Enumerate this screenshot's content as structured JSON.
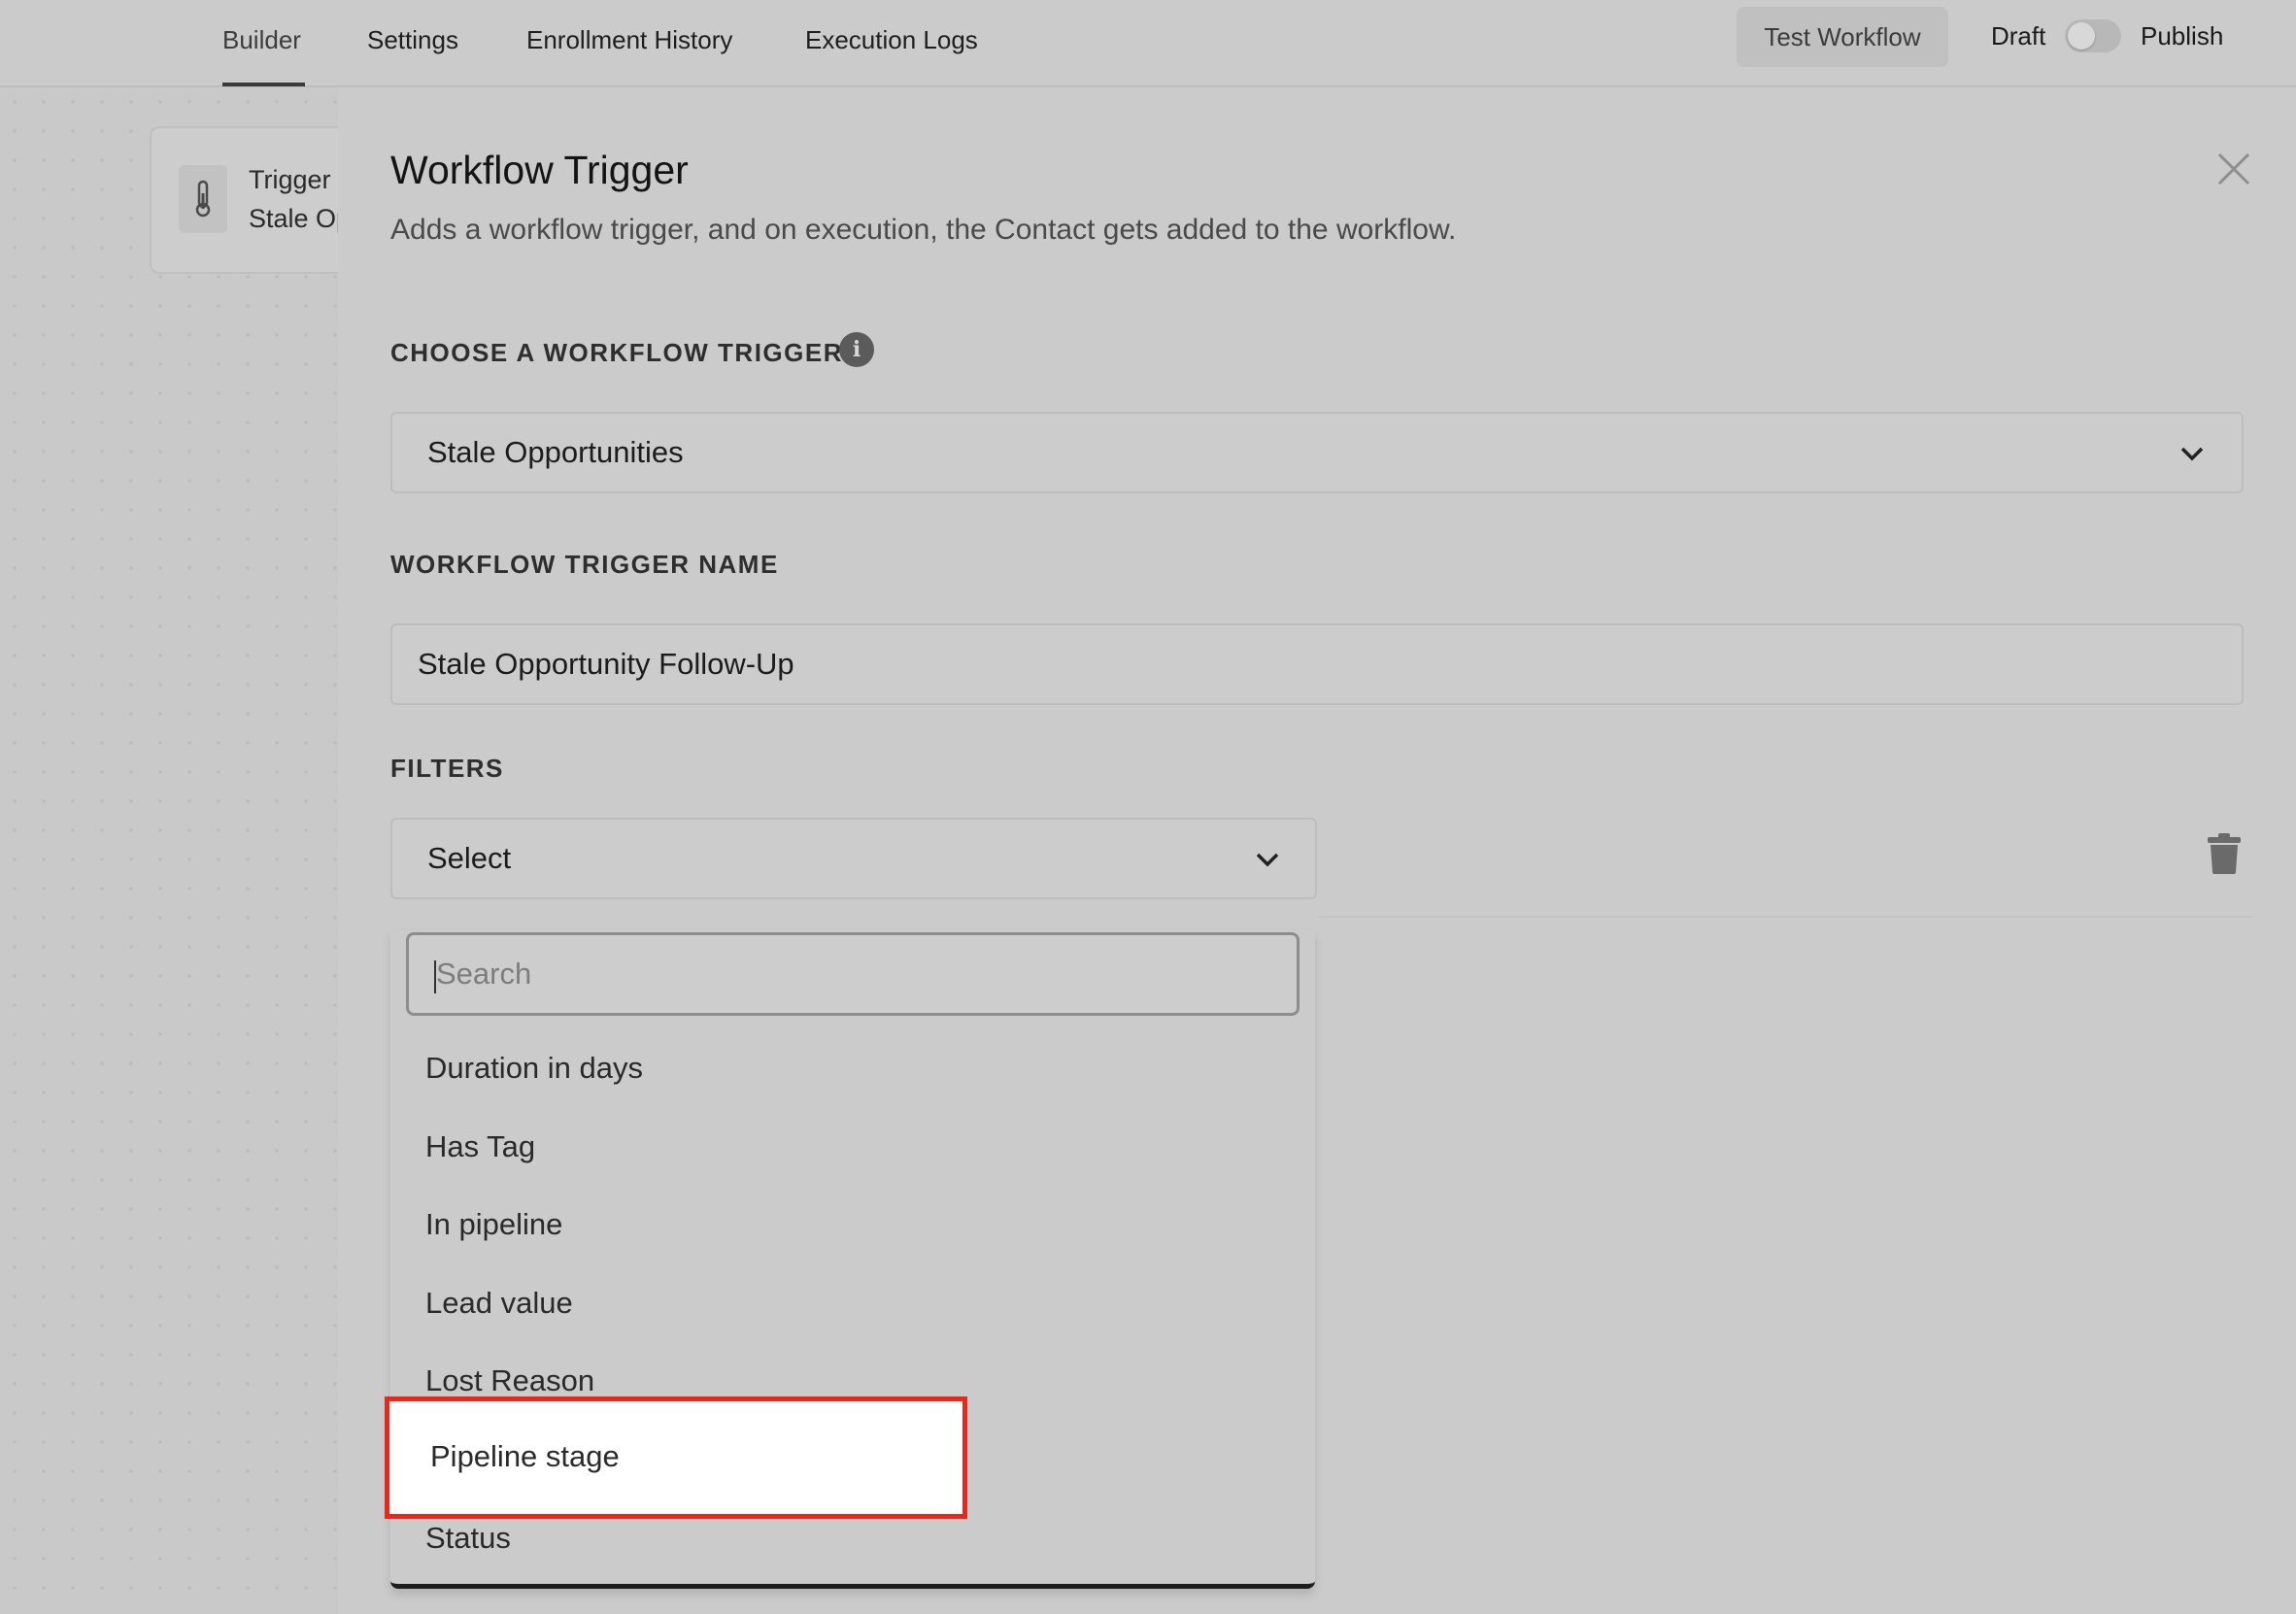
{
  "topnav": {
    "tabs": [
      {
        "label": "Builder",
        "active": true
      },
      {
        "label": "Settings",
        "active": false
      },
      {
        "label": "Enrollment History",
        "active": false
      },
      {
        "label": "Execution Logs",
        "active": false
      }
    ],
    "test_button": "Test Workflow",
    "draft_label": "Draft",
    "publish_label": "Publish",
    "publish_toggle_on": false
  },
  "canvas": {
    "trigger_card": {
      "line1": "Trigger",
      "line2": "Stale Op",
      "icon": "thermometer-icon"
    }
  },
  "panel": {
    "title": "Workflow Trigger",
    "subtitle": "Adds a workflow trigger, and on execution, the Contact gets added to the workflow.",
    "choose_label": "CHOOSE A WORKFLOW TRIGGER",
    "trigger_select_value": "Stale Opportunities",
    "name_label": "WORKFLOW TRIGGER NAME",
    "name_value": "Stale Opportunity Follow-Up",
    "filters_label": "FILTERS",
    "filter_select_value": "Select",
    "dropdown": {
      "search_placeholder": "Search",
      "options": [
        "Duration in days",
        "Has Tag",
        "In pipeline",
        "Lead value",
        "Lost Reason",
        "Pipeline stage",
        "Status"
      ],
      "highlighted_option": "Pipeline stage"
    }
  },
  "colors": {
    "background": "#cbcbcb",
    "highlight_border": "#e8281c",
    "highlight_fill": "#ffffff"
  }
}
